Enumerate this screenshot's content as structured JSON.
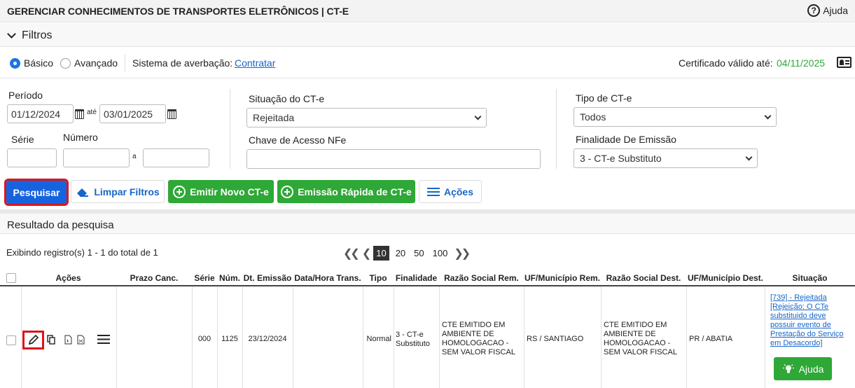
{
  "header": {
    "title": "GERENCIAR CONHECIMENTOS DE TRANSPORTES ELETRÔNICOS | CT-E",
    "help": "Ajuda",
    "help_symbol": "?"
  },
  "filters": {
    "label": "Filtros",
    "basic": "Básico",
    "advanced": "Avançado",
    "averbacao_label": "Sistema de averbação:",
    "averbacao_link": "Contratar",
    "cert_label": "Certificado válido até:",
    "cert_date": "04/11/2025"
  },
  "form": {
    "periodo_label": "Período",
    "periodo_from": "01/12/2024",
    "ate": "até",
    "periodo_to": "03/01/2025",
    "serie_label": "Série",
    "numero_label": "Número",
    "a": "a",
    "situacao_label": "Situação do CT-e",
    "situacao_value": "Rejeitada",
    "chave_label": "Chave de Acesso NFe",
    "tipo_label": "Tipo de CT-e",
    "tipo_value": "Todos",
    "finalidade_label": "Finalidade De Emissão",
    "finalidade_value": "3 - CT-e Substituto"
  },
  "buttons": {
    "pesquisar": "Pesquisar",
    "limpar": "Limpar Filtros",
    "emitir": "Emitir Novo CT-e",
    "rapida": "Emissão Rápida de CT-e",
    "acoes": "Ações"
  },
  "results": {
    "title": "Resultado da pesquisa",
    "showing": "Exibindo registro(s) 1 - 1 do total de 1",
    "page_sizes": [
      "10",
      "20",
      "50",
      "100"
    ],
    "selected_page_size": "10"
  },
  "table": {
    "headers": [
      "Ações",
      "Prazo Canc.",
      "Série",
      "Núm.",
      "Dt. Emissão",
      "Data/Hora Trans.",
      "Tipo",
      "Finalidade",
      "Razão Social Rem.",
      "UF/Município Rem.",
      "Razão Social Dest.",
      "UF/Município Dest.",
      "Situação"
    ],
    "row": {
      "prazo": "",
      "serie": "000",
      "num": "1125",
      "dt_emissao": "23/12/2024",
      "data_trans": "",
      "tipo": "Normal",
      "finalidade": "3 - CT-e Substituto",
      "rem": "CTE EMITIDO EM AMBIENTE DE HOMOLOGACAO - SEM VALOR FISCAL",
      "uf_rem": "RS / SANTIAGO",
      "dest": "CTE EMITIDO EM AMBIENTE DE HOMOLOGACAO - SEM VALOR FISCAL",
      "uf_dest": "PR / ABATIA",
      "situacao": "[739] - Rejeitada [Rejeição: O CTe substituido deve possuir evento de Prestação do Serviço em Desacordo]",
      "ajuda": "Ajuda"
    }
  },
  "colors": {
    "accent": "#1663e0",
    "green": "#2ea836",
    "highlight": "#d9161c",
    "link": "#1766c8"
  }
}
